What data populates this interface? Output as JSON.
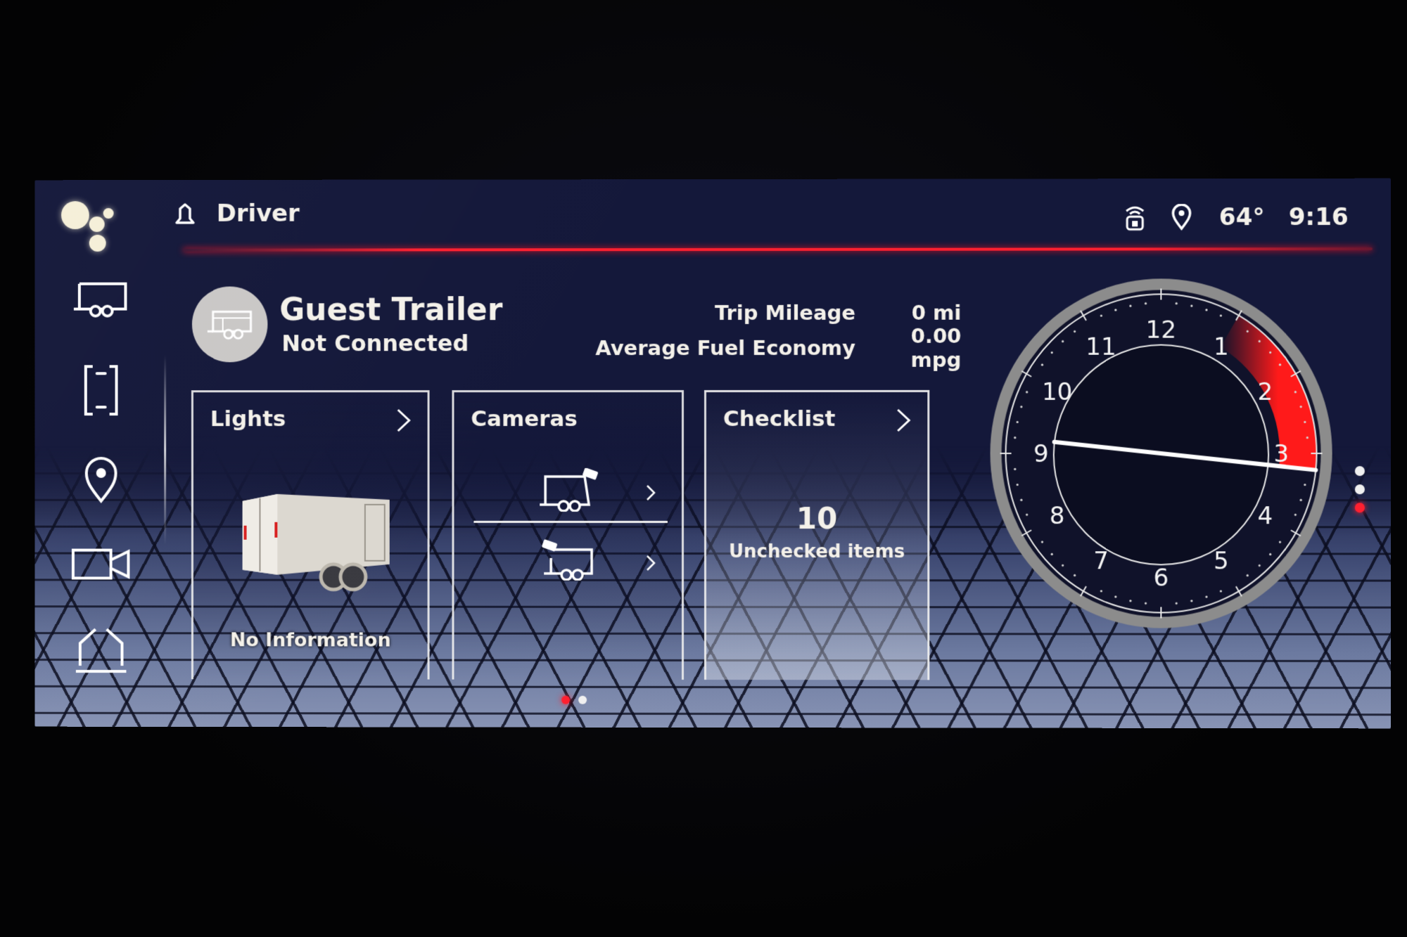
{
  "header": {
    "profile_label": "Driver",
    "temperature": "64°",
    "time": "9:16",
    "icons": [
      "assistant-icon",
      "notification-bell-icon",
      "wifi-hotspot-icon",
      "location-pin-icon"
    ]
  },
  "sidebar": {
    "items": [
      {
        "name": "trailer",
        "icon": "trailer-icon"
      },
      {
        "name": "phone",
        "icon": "phone-icon"
      },
      {
        "name": "navigation",
        "icon": "location-pin-icon"
      },
      {
        "name": "camera",
        "icon": "video-camera-icon"
      },
      {
        "name": "home",
        "icon": "home-icon"
      }
    ]
  },
  "trailer": {
    "name": "Guest Trailer",
    "status": "Not Connected",
    "stats": [
      {
        "label": "Trip Mileage",
        "value": "0 mi"
      },
      {
        "label": "Average Fuel Economy",
        "value": "0.00 mpg"
      }
    ]
  },
  "cards": {
    "lights": {
      "title": "Lights",
      "status": "No Information"
    },
    "cameras": {
      "title": "Cameras",
      "items": [
        {
          "name": "rear-camera"
        },
        {
          "name": "side-camera"
        }
      ]
    },
    "checklist": {
      "title": "Checklist",
      "count": "10",
      "label": "Unchecked items"
    }
  },
  "clock": {
    "numerals": [
      "12",
      "1",
      "2",
      "3",
      "4",
      "5",
      "6",
      "7",
      "8",
      "9",
      "10",
      "11"
    ],
    "hour": 9,
    "minute": 16,
    "accent": "#ff1a1a"
  },
  "pagination": {
    "pages": 2,
    "current": 1
  },
  "side_pager": {
    "pages": 3,
    "current": 3
  },
  "colors": {
    "accent": "#ff2030",
    "background": "#14183a",
    "foreground": "#f4f1ea"
  }
}
